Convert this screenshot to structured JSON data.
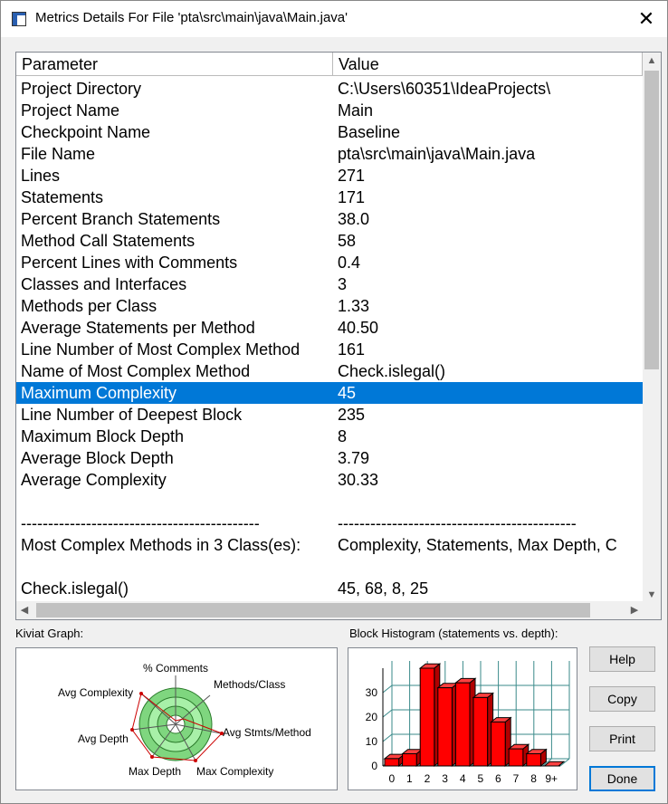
{
  "window": {
    "title": "Metrics Details For File 'pta\\src\\main\\java\\Main.java'",
    "close_icon": "close-icon"
  },
  "table": {
    "columns": [
      "Parameter",
      "Value"
    ],
    "selected_row": 14,
    "rows": [
      {
        "param": "Project Directory",
        "value": "C:\\Users\\60351\\IdeaProjects\\"
      },
      {
        "param": "Project Name",
        "value": "Main"
      },
      {
        "param": "Checkpoint Name",
        "value": "Baseline"
      },
      {
        "param": "File Name",
        "value": "pta\\src\\main\\java\\Main.java"
      },
      {
        "param": "Lines",
        "value": "271"
      },
      {
        "param": "Statements",
        "value": "171"
      },
      {
        "param": "Percent Branch Statements",
        "value": "38.0"
      },
      {
        "param": "Method Call Statements",
        "value": "58"
      },
      {
        "param": "Percent Lines with Comments",
        "value": "0.4"
      },
      {
        "param": "Classes and Interfaces",
        "value": "3"
      },
      {
        "param": "Methods per Class",
        "value": "1.33"
      },
      {
        "param": "Average Statements per Method",
        "value": "40.50"
      },
      {
        "param": "Line Number of Most Complex Method",
        "value": "161"
      },
      {
        "param": "Name of Most Complex Method",
        "value": "Check.islegal()"
      },
      {
        "param": "Maximum Complexity",
        "value": "45"
      },
      {
        "param": "Line Number of Deepest Block",
        "value": "235"
      },
      {
        "param": "Maximum Block Depth",
        "value": "8"
      },
      {
        "param": "Average Block Depth",
        "value": "3.79"
      },
      {
        "param": "Average Complexity",
        "value": "30.33"
      },
      {
        "param": "",
        "value": ""
      },
      {
        "param": "--------------------------------------------",
        "value": "--------------------------------------------"
      },
      {
        "param": "Most Complex Methods in 3 Class(es):",
        "value": "Complexity, Statements, Max Depth, C"
      },
      {
        "param": "",
        "value": ""
      },
      {
        "param": "Check.islegal()",
        "value": "45, 68, 8, 25"
      }
    ]
  },
  "kiviat": {
    "label": "Kiviat Graph:",
    "axes": [
      "% Comments",
      "Methods/Class",
      "Avg Stmts/Method",
      "Max Complexity",
      "Max Depth",
      "Avg Depth",
      "Avg Complexity"
    ]
  },
  "histogram": {
    "label": "Block Histogram (statements vs. depth):",
    "bar_color": "#ff0000"
  },
  "chart_data": {
    "type": "bar",
    "categories": [
      "0",
      "1",
      "2",
      "3",
      "4",
      "5",
      "6",
      "7",
      "8",
      "9+"
    ],
    "values": [
      3,
      5,
      40,
      32,
      34,
      28,
      18,
      7,
      5,
      0
    ],
    "yticks": [
      "0",
      "10",
      "20",
      "30"
    ],
    "ylim": [
      0,
      40
    ],
    "grid": true
  },
  "buttons": {
    "help": "Help",
    "copy": "Copy",
    "print": "Print",
    "done": "Done"
  }
}
